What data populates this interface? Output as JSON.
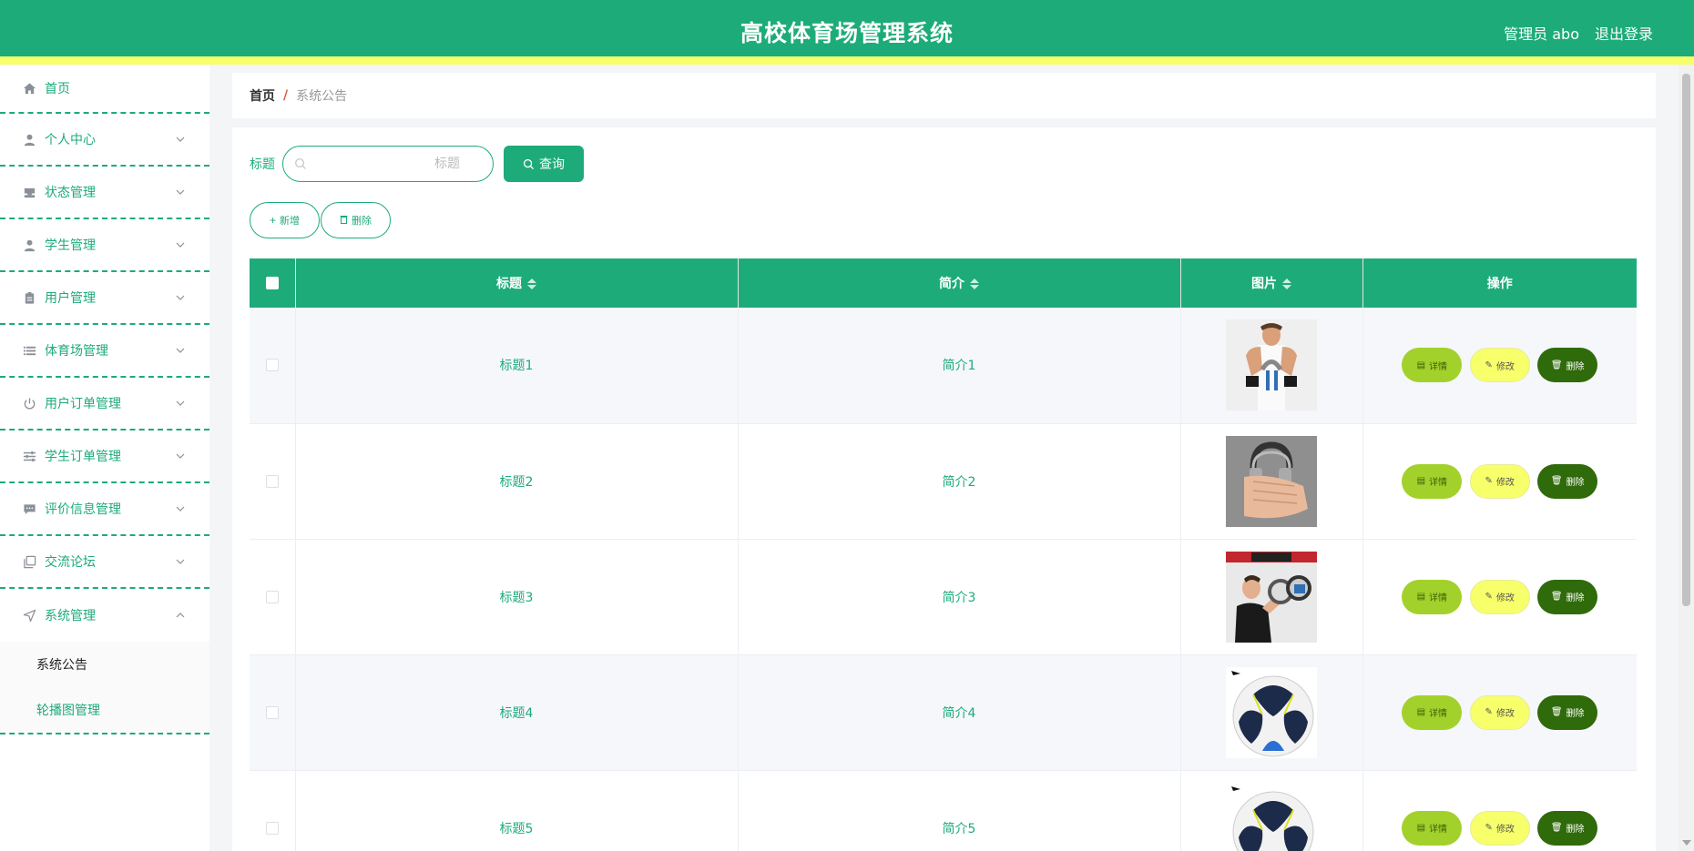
{
  "header": {
    "title": "高校体育场管理系统",
    "user": "管理员 abo",
    "logout": "退出登录"
  },
  "sidebar": {
    "items": [
      {
        "label": "首页",
        "icon": "home-icon"
      },
      {
        "label": "个人中心",
        "icon": "user-icon"
      },
      {
        "label": "状态管理",
        "icon": "tray-icon"
      },
      {
        "label": "学生管理",
        "icon": "user-icon"
      },
      {
        "label": "用户管理",
        "icon": "clipboard-icon"
      },
      {
        "label": "体育场管理",
        "icon": "list-icon"
      },
      {
        "label": "用户订单管理",
        "icon": "power-icon"
      },
      {
        "label": "学生订单管理",
        "icon": "sliders-icon"
      },
      {
        "label": "评价信息管理",
        "icon": "chat-icon"
      },
      {
        "label": "交流论坛",
        "icon": "copy-icon"
      },
      {
        "label": "系统管理",
        "icon": "navigation-icon"
      }
    ],
    "submenu": [
      "系统公告",
      "轮播图管理"
    ]
  },
  "breadcrumb": {
    "home": "首页",
    "separator": "/",
    "current": "系统公告"
  },
  "search": {
    "label": "标题",
    "placeholder": "标题",
    "query_label": "查询"
  },
  "actions": {
    "add": "新增",
    "delete": "删除"
  },
  "table": {
    "columns": [
      "标题",
      "简介",
      "图片",
      "操作"
    ],
    "rows": [
      {
        "title": "标题1",
        "intro": "简介1",
        "image": "man-with-hand-gripper"
      },
      {
        "title": "标题2",
        "intro": "简介2",
        "image": "hand-gripper"
      },
      {
        "title": "标题3",
        "intro": "简介3",
        "image": "man-with-arm-exerciser"
      },
      {
        "title": "标题4",
        "intro": "简介4",
        "image": "soccer-ball"
      },
      {
        "title": "标题5",
        "intro": "简介5",
        "image": "soccer-ball"
      }
    ],
    "op_labels": {
      "detail": "详情",
      "edit": "修改",
      "delete": "删除"
    }
  },
  "colors": {
    "primary": "#1dab7a",
    "accent": "#f7ff6b",
    "detail": "#a3d12b",
    "danger": "#2f6a0b"
  }
}
